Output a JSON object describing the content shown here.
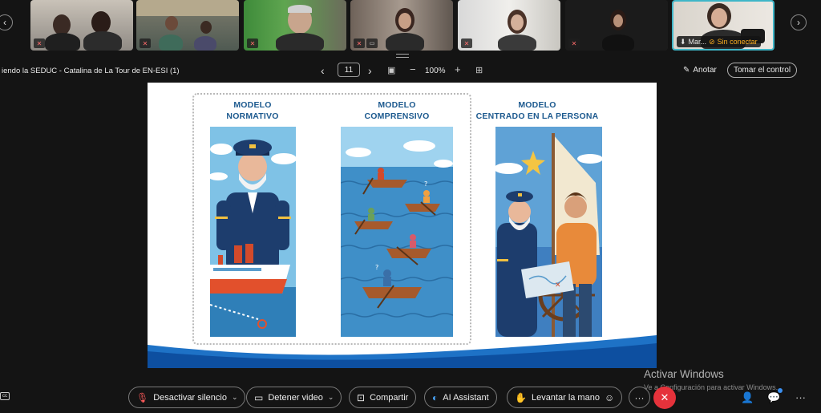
{
  "participants": [
    {
      "name": ""
    },
    {
      "name": ""
    },
    {
      "name": ""
    },
    {
      "name": ""
    },
    {
      "name": ""
    },
    {
      "name": ""
    },
    {
      "name": "Mar...",
      "status": "Sin conectar"
    }
  ],
  "share_bar": {
    "title": "iendo la SEDUC - Catalina de La Tour de EN-ESI (1)",
    "page": "11",
    "zoom": "100%",
    "annotate_label": "Anotar",
    "take_control_label": "Tomar el control"
  },
  "slide": {
    "col1": {
      "line1": "MODELO",
      "line2": "NORMATIVO"
    },
    "col2": {
      "line1": "MODELO",
      "line2": "COMPRENSIVO"
    },
    "col3": {
      "line1": "MODELO",
      "line2": "CENTRADO EN LA PERSONA"
    }
  },
  "controls": {
    "mute_label": "Desactivar silencio",
    "video_label": "Detener video",
    "share_label": "Compartir",
    "ai_label": "AI Assistant",
    "hand_label": "Levantar la mano"
  },
  "watermark": {
    "line1": "Activar Windows",
    "line2": "Ve a Configuración para activar Windows."
  },
  "colors": {
    "accent": "#3fb6c8",
    "end_call": "#e5323b",
    "slide_title": "#1d5a8f"
  }
}
